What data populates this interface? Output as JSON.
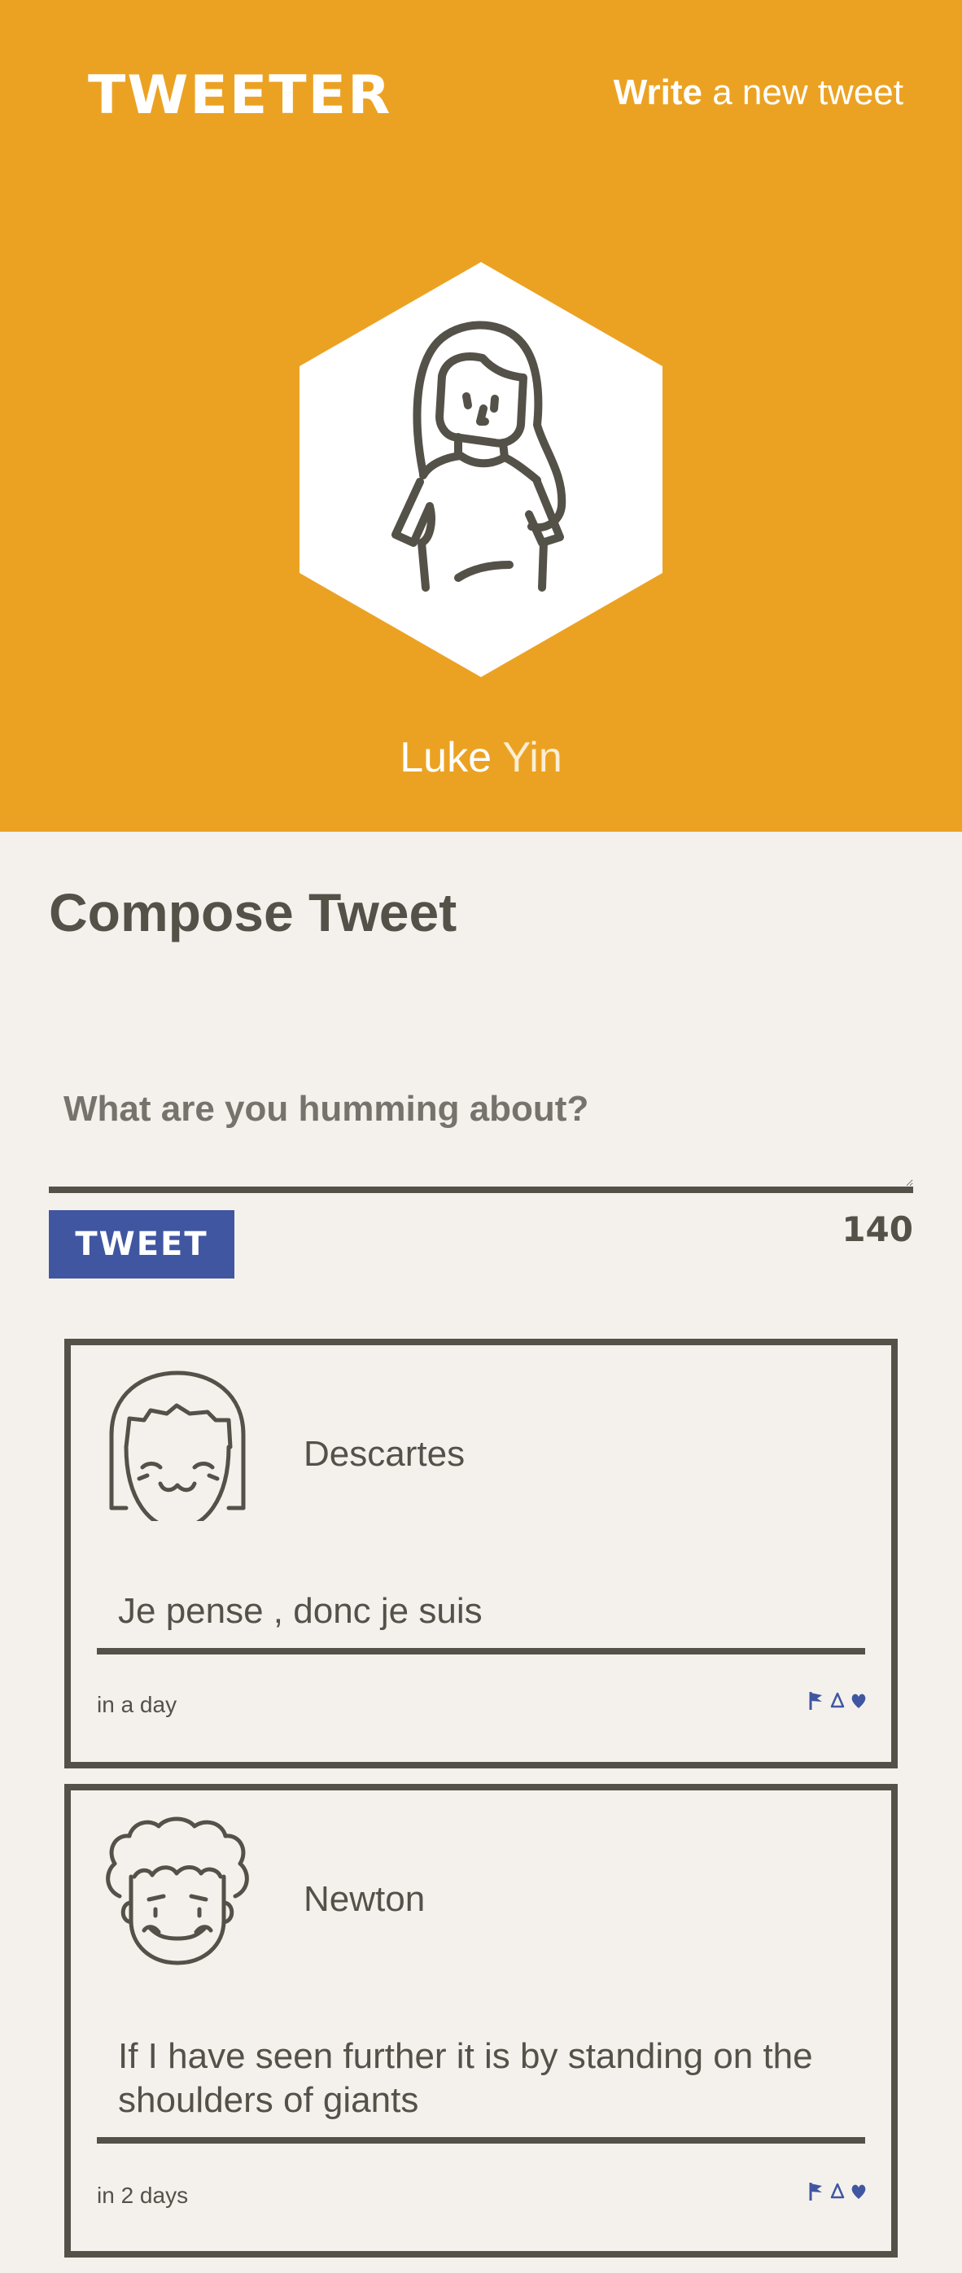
{
  "header": {
    "brand": "TWEETER",
    "write_strong": "Write",
    "write_rest": " a new tweet",
    "user_first": "Luke",
    "user_last": "Yin"
  },
  "compose": {
    "title": "Compose Tweet",
    "placeholder": "What are you humming about?",
    "button_label": "TWEET",
    "counter": "140"
  },
  "tweets": [
    {
      "name": "Descartes",
      "content": "Je pense , donc je suis",
      "time": "in a day"
    },
    {
      "name": "Newton",
      "content": "If I have seen further it is by standing on the shoulders of giants",
      "time": "in 2 days"
    }
  ],
  "colors": {
    "header_bg": "#eba223",
    "page_bg": "#f4f1ed",
    "text": "#545149",
    "button": "#4056a1"
  },
  "icons": {
    "actions": [
      "flag-icon",
      "retweet-icon",
      "heart-icon"
    ]
  }
}
